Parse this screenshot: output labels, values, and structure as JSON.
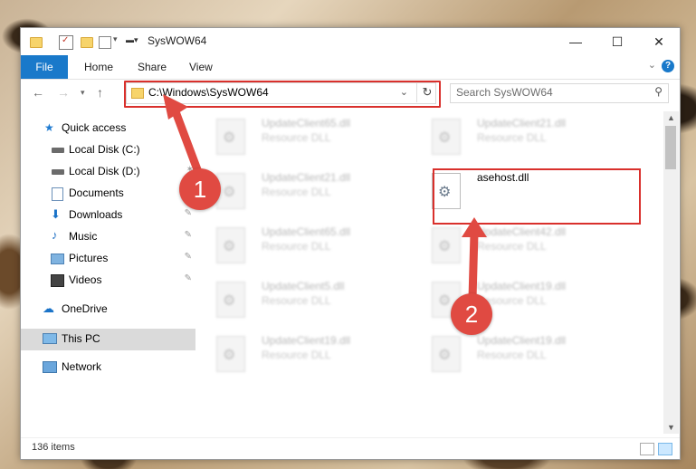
{
  "window": {
    "title": "SysWOW64",
    "controls": {
      "minimize": "—",
      "maximize": "☐",
      "close": "✕"
    }
  },
  "ribbon": {
    "tabs": [
      "File",
      "Home",
      "Share",
      "View"
    ],
    "help": "?"
  },
  "address": {
    "path": "C:\\Windows\\SysWOW64",
    "search_placeholder": "Search SysWOW64"
  },
  "sidebar": {
    "items": [
      {
        "label": "Quick access",
        "icon": "star-icon"
      },
      {
        "label": "Local Disk (C:)",
        "icon": "drive-icon"
      },
      {
        "label": "Local Disk (D:)",
        "icon": "drive-icon"
      },
      {
        "label": "Documents",
        "icon": "documents-icon"
      },
      {
        "label": "Downloads",
        "icon": "downloads-icon"
      },
      {
        "label": "Music",
        "icon": "music-icon"
      },
      {
        "label": "Pictures",
        "icon": "pictures-icon"
      },
      {
        "label": "Videos",
        "icon": "videos-icon"
      },
      {
        "label": "OneDrive",
        "icon": "cloud-icon"
      },
      {
        "label": "This PC",
        "icon": "computer-icon"
      },
      {
        "label": "Network",
        "icon": "network-icon"
      }
    ]
  },
  "files": [
    {
      "name": "UpdateClient65.dll",
      "type": "Resource DLL"
    },
    {
      "name": "UpdateClient21.dll",
      "type": "Resource DLL"
    },
    {
      "name": "UpdateClient21.dll",
      "type": "Resource DLL"
    },
    {
      "name": "asehost.dll",
      "type": ""
    },
    {
      "name": "UpdateClient65.dll",
      "type": "Resource DLL"
    },
    {
      "name": "UpdateClient42.dll",
      "type": "Resource DLL"
    },
    {
      "name": "UpdateClient5.dll",
      "type": "Resource DLL"
    },
    {
      "name": "UpdateClient19.dll",
      "type": "Resource DLL"
    },
    {
      "name": "UpdateClient19.dll",
      "type": "Resource DLL"
    },
    {
      "name": "UpdateClient19.dll",
      "type": "Resource DLL"
    }
  ],
  "status": {
    "items": "136 items"
  },
  "annotations": {
    "step1": "1",
    "step2": "2",
    "color": "#e04a42"
  }
}
